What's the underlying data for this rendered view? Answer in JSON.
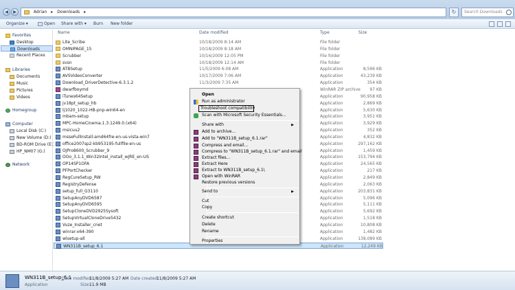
{
  "address": {
    "segments": [
      "Adrian",
      "▸",
      "Downloads",
      "▸"
    ]
  },
  "search": {
    "placeholder": "Search Downloads"
  },
  "toolbar": {
    "organize": "Organize ▾",
    "open": "Open",
    "share": "Share with ▾",
    "burn": "Burn",
    "new_folder": "New folder"
  },
  "nav": {
    "favorites": "Favorites",
    "desktop": "Desktop",
    "downloads": "Downloads",
    "recent": "Recent Places",
    "libraries": "Libraries",
    "documents": "Documents",
    "music": "Music",
    "pictures": "Pictures",
    "videos": "Videos",
    "homegroup": "Homegroup",
    "computer": "Computer",
    "local_disk": "Local Disk (C:)",
    "new_volume": "New Volume (D:)",
    "bd_rom": "BD-ROM Drive (E:) L",
    "hp": "HP_NM07 (G:)",
    "network": "Network"
  },
  "columns": {
    "name": "Name",
    "date": "Date modified",
    "type": "Type",
    "size": "Size"
  },
  "files": [
    {
      "name": "Lite_Scribe",
      "date": "10/18/2009 8:14 AM",
      "type": "File folder",
      "size": "",
      "icon": "folder"
    },
    {
      "name": "OMNIPAGE_15",
      "date": "10/18/2009 8:18 AM",
      "type": "File folder",
      "size": "",
      "icon": "folder"
    },
    {
      "name": "Scrubber",
      "date": "10/16/2009 12:05 PM",
      "type": "File folder",
      "size": "",
      "icon": "folder"
    },
    {
      "name": "svsn",
      "date": "10/18/2009 12:14 AM",
      "type": "File folder",
      "size": "",
      "icon": "folder"
    },
    {
      "name": "ATBSetup",
      "date": "11/5/2009 6:08 AM",
      "type": "Application",
      "size": "8,596 KB",
      "icon": "app"
    },
    {
      "name": "AVSVideoConverter",
      "date": "10/17/2009 7:06 AM",
      "type": "Application",
      "size": "43,239 KB",
      "icon": "app"
    },
    {
      "name": "Download_DriverDetective-6.3.1.2",
      "date": "11/3/2009 7:35 AM",
      "type": "Application",
      "size": "354 KB",
      "icon": "app"
    },
    {
      "name": "dwarfboymd",
      "date": "",
      "type": "WinRAR ZIP archive",
      "size": "97 KB",
      "icon": "zip"
    },
    {
      "name": "iTunes64Setup",
      "date": "",
      "type": "Application",
      "size": "90,958 KB",
      "icon": "app"
    },
    {
      "name": "jv18pt_setup_hb",
      "date": "",
      "type": "Application",
      "size": "2,869 KB",
      "icon": "app"
    },
    {
      "name": "lj1020_1022-HB-pnp-win64-en",
      "date": "",
      "type": "Application",
      "size": "5,630 KB",
      "icon": "app"
    },
    {
      "name": "mbam-setup",
      "date": "",
      "type": "Application",
      "size": "3,951 KB",
      "icon": "app"
    },
    {
      "name": "MPC-HomeCinema.1.3.1249.0.(x64)",
      "date": "",
      "type": "Application",
      "size": "3,929 KB",
      "icon": "app"
    },
    {
      "name": "msicuu2",
      "date": "",
      "type": "Application",
      "size": "352 KB",
      "icon": "app"
    },
    {
      "name": "msseFullInstall-amd64fre-en-us-vista-win7",
      "date": "",
      "type": "Application",
      "size": "4,832 KB",
      "icon": "app"
    },
    {
      "name": "office2007sp2-kb953195-fullfile-en-us",
      "date": "",
      "type": "Application",
      "size": "297,162 KB",
      "icon": "app"
    },
    {
      "name": "OJPro8600_Scrubber_9",
      "date": "",
      "type": "Application",
      "size": "1,459 KB",
      "icon": "app"
    },
    {
      "name": "OOo_3.1.1_Win32Intel_install_wJRE_en-US",
      "date": "",
      "type": "Application",
      "size": "153,794 KB",
      "icon": "app"
    },
    {
      "name": "OP14SP1OFA",
      "date": "",
      "type": "Application",
      "size": "24,565 KB",
      "icon": "app"
    },
    {
      "name": "PFPortChecker",
      "date": "",
      "type": "Application",
      "size": "217 KB",
      "icon": "app"
    },
    {
      "name": "RegCureSetup_RW",
      "date": "",
      "type": "Application",
      "size": "2,849 KB",
      "icon": "app"
    },
    {
      "name": "RegistryDefense",
      "date": "",
      "type": "Application",
      "size": "2,063 KB",
      "icon": "app"
    },
    {
      "name": "setup_full_G3110",
      "date": "",
      "type": "Application",
      "size": "203,831 KB",
      "icon": "app"
    },
    {
      "name": "SetupAnyDVD6587",
      "date": "",
      "type": "Application",
      "size": "5,096 KB",
      "icon": "app"
    },
    {
      "name": "SetupAnyDVD6595",
      "date": "",
      "type": "Application",
      "size": "5,111 KB",
      "icon": "app"
    },
    {
      "name": "SetupCloneDVD2925Sysoft",
      "date": "",
      "type": "Application",
      "size": "5,692 KB",
      "icon": "app"
    },
    {
      "name": "SetupVirtualCloneDrive5432",
      "date": "",
      "type": "Application",
      "size": "1,518 KB",
      "icon": "app"
    },
    {
      "name": "Vuze_Installer_cnet",
      "date": "",
      "type": "Application",
      "size": "10,808 KB",
      "icon": "app"
    },
    {
      "name": "winrar-x64-390",
      "date": "",
      "type": "Application",
      "size": "1,482 KB",
      "icon": "app"
    },
    {
      "name": "wlsetup-all",
      "date": "",
      "type": "Application",
      "size": "138,089 KB",
      "icon": "app"
    },
    {
      "name": "WN311B_setup_6.1",
      "date": "",
      "type": "Application",
      "size": "12,249 KB",
      "icon": "app"
    }
  ],
  "context_menu": {
    "open": "Open",
    "run_admin": "Run as administrator",
    "troubleshoot": "Troubleshoot compatibility",
    "scan": "Scan with Microsoft Security Essentials...",
    "share_with": "Share with",
    "add_archive": "Add to archive...",
    "add_rar": "Add to \"WN311B_setup_6.1.rar\"",
    "compress_email": "Compress and email...",
    "compress_rar_email": "Compress to \"WN311B_setup_6.1.rar\" and email",
    "extract_files": "Extract files...",
    "extract_here": "Extract Here",
    "extract_to": "Extract to WN311B_setup_6.1\\",
    "open_winrar": "Open with WinRAR",
    "restore": "Restore previous versions",
    "send_to": "Send to",
    "cut": "Cut",
    "copy": "Copy",
    "create_shortcut": "Create shortcut",
    "delete": "Delete",
    "rename": "Rename",
    "properties": "Properties"
  },
  "details": {
    "name": "WN311B_setup_6.1",
    "type": "Application",
    "date_modified_label": "Date modified:",
    "date_modified": "11/8/2009 5:27 AM",
    "date_created_label": "Date created:",
    "date_created": "11/8/2009 5:27 AM",
    "size_label": "Size:",
    "size": "11.9 MB"
  }
}
